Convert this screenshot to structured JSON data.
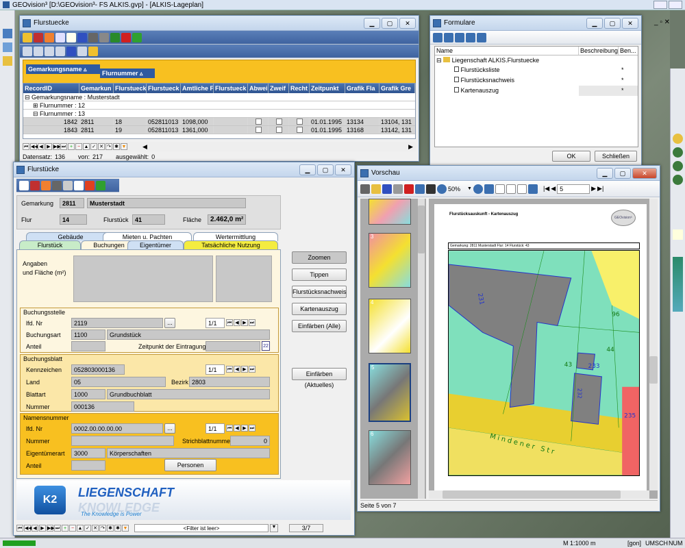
{
  "app": {
    "title": "GEOvision³  [D:\\GEOvision³- FS ALKIS.gvp] - [ALKIS-Lageplan]"
  },
  "status_bar": {
    "scale": "M 1:1000  m",
    "unit": "[gon]",
    "caps": "UMSCH",
    "num": "NUM"
  },
  "flurstuecke_win": {
    "title": "Flurstuecke",
    "group_a": "Gemarkungsname",
    "group_b": "Flurnummer",
    "columns": [
      "RecordID",
      "Gemarkun",
      "Flurstueck",
      "Flurstueck",
      "Amtliche F",
      "Flurstueck",
      "Abwei",
      "Zweif",
      "Recht",
      "Zeitpunkt",
      "Grafik Fla",
      "Grafik Gre"
    ],
    "group_rows": [
      "Gemarkungsname : Musterstadt",
      "Flurnummer : 12",
      "Flurnummer : 13"
    ],
    "rows": [
      [
        "1842",
        "2811",
        "18",
        "052811013",
        "1098,000",
        "",
        "",
        "",
        "",
        "01.01.1995",
        "13134",
        "13104, 131"
      ],
      [
        "1843",
        "2811",
        "19",
        "052811013",
        "1361,000",
        "",
        "",
        "",
        "",
        "01.01.1995",
        "13168",
        "13142, 131"
      ]
    ],
    "status_datensatz": "Datensatz:",
    "datensatz_val": "136",
    "von_label": "von:",
    "von_val": "217",
    "ausgewaehlt_label": "ausgewählt:",
    "ausgewaehlt_val": "0"
  },
  "formulare_win": {
    "title": "Formulare",
    "col_name": "Name",
    "col_desc": "Beschreibung",
    "col_ben": "Ben...",
    "root": "Liegenschaft ALKIS.Flurstuecke",
    "items": [
      "Flurstücksliste",
      "Flurstücksnachweis",
      "Kartenauszug"
    ],
    "mark": "*",
    "ok": "OK",
    "close": "Schließen"
  },
  "fst_win": {
    "title": "Flurstücke",
    "gemarkung_label": "Gemarkung",
    "gemarkung_nr": "2811",
    "gemarkung_name": "Musterstadt",
    "flur_label": "Flur",
    "flur_val": "14",
    "flurstueck_label": "Flurstück",
    "flurstueck_val": "41",
    "flaeche_label": "Fläche",
    "flaeche_val": "2.462,0 m²",
    "tabs_back": [
      "Gebäude",
      "Mieten u. Pachten",
      "Wertermittlung"
    ],
    "tabs_front": [
      "Flurstück",
      "Buchungen",
      "Eigentümer",
      "Tatsächliche Nutzung"
    ],
    "angaben_label": "Angaben\nund Fläche (m²)",
    "bs_title": "Buchungsstelle",
    "lfd_label": "lfd. Nr",
    "lfd_val": "2119",
    "pager": "1/1",
    "buchungsart_label": "Buchungsart",
    "buchungsart_nr": "1100",
    "buchungsart_name": "Grundstück",
    "anteil_label": "Anteil",
    "zeitpunkt_label": "Zeitpunkt der Eintragung",
    "cal": "22",
    "bb_title": "Buchungsblatt",
    "kennzeichen_label": "Kennzeichen",
    "kennzeichen_val": "052803000136",
    "land_label": "Land",
    "land_val": "05",
    "bezirk_label": "Bezirk",
    "bezirk_val": "2803",
    "blattart_label": "Blattart",
    "blattart_nr": "1000",
    "blattart_name": "Grundbuchblatt",
    "nummer_label": "Nummer",
    "nummer_val": "000136",
    "nn_title": "Namensnummer",
    "nn_lfd_val": "0002.00.00.00.00",
    "nn_nummer_label": "Nummer",
    "strich_label": "Strichblattnummer",
    "strich_val": "0",
    "eig_label": "Eigentümerart",
    "eig_nr": "3000",
    "eig_name": "Körperschaften",
    "nn_anteil_label": "Anteil",
    "personen": "Personen",
    "dots": "...",
    "buttons": [
      "Zoomen",
      "Tippen",
      "Flurstücksnachweis",
      "Kartenauszug",
      "Einfärben (Alle)",
      "Einfärben (Aktuelles)"
    ],
    "banner_title": "LIEGENSCHAFT",
    "banner_brand": "KNOWLEDGE",
    "banner_slogan": "The Knowledge is Power",
    "k2": "K2",
    "filter": "<Filter ist leer>",
    "page": "3/7"
  },
  "vorschau_win": {
    "title": "Vorschau",
    "zoom": "50%",
    "page_input": "5",
    "status": "Seite 5 von 7",
    "thumb_nums": [
      "3",
      "4",
      "5",
      "6"
    ],
    "doc_header": "Flurstücksauskunft - Kartenauszug",
    "doc_sub": "Gemarkung: 2811 Musterstadt  Flur: 14   Flurstück: 43",
    "logo_text": "GEOvision³",
    "map_labels": [
      "231",
      "96",
      "44",
      "43",
      "233",
      "232",
      "235"
    ],
    "street": "Mindener Str"
  }
}
